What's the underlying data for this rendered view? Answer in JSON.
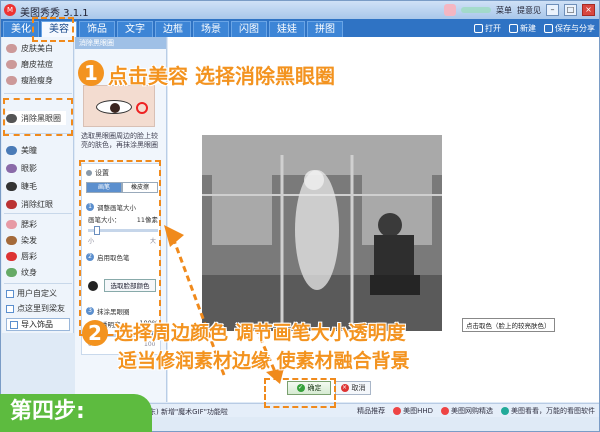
{
  "window": {
    "title": "美图秀秀 3.1.1",
    "top_right": {
      "menu_label": "菜单",
      "feedback_label": "提意见"
    }
  },
  "top_tabs": [
    "美化",
    "美容",
    "饰品",
    "文字",
    "边框",
    "场景",
    "闪图",
    "娃娃",
    "拼图"
  ],
  "toolbar": {
    "open_label": "打开",
    "new_label": "新建",
    "save_label": "保存与分享"
  },
  "sidebar": {
    "items": [
      "皮肤美白",
      "磨皮祛痘",
      "瘦脸瘦身",
      "消除黑眼圈",
      "美瞳",
      "眼影",
      "睫毛",
      "消除红眼",
      "腮彩",
      "染发",
      "唇彩",
      "纹身"
    ],
    "links": [
      "用户自定义",
      "点这里到梁友"
    ],
    "import_button": "导入饰品"
  },
  "tool_panel": {
    "header": "消除黑眼圈",
    "description": "选取黑眼圈周边的脸上较亮的肤色，再抹涂黑眼圈",
    "settings": {
      "title": "设置",
      "modes": [
        "画笔",
        "橡皮擦"
      ],
      "step1": "调整画笔大小",
      "brush_size_label": "画笔大小：",
      "brush_size_value": "11像素",
      "brush_range_min": "小",
      "brush_range_max": "大",
      "step2": "启用取色笔",
      "pick_color_button": "选取脸部颜色",
      "step3": "抹涂黑眼圈",
      "opacity_label": "画笔透明度：",
      "opacity_value": "100%",
      "opacity_range_min": "0",
      "opacity_range_max": "100"
    }
  },
  "canvas": {
    "tooltip": "点击取色（脸上的较亮肤色）",
    "ok_button": "确定",
    "cancel_button": "取消"
  },
  "statusbar": {
    "left_text": "东)  新增\"魔术GIF\"功能啦",
    "right_items": [
      "精品推荐",
      "美图HHD",
      "美图网购精选",
      "美图看看，万能的看图软件"
    ]
  },
  "instructions": {
    "badge1": "1",
    "text1": "点击美容 选择消除黑眼圈",
    "badge2": "2",
    "text2_line1": "选择周边颜色 调节画笔大小透明度",
    "text2_line2": "适当修润素材边缘 使素材融合背景",
    "step_banner": "第四步:"
  },
  "colors": {
    "accent_orange": "#f3931f",
    "banner_green": "#5dbb3f",
    "tab_blue": "#2f73c4"
  }
}
